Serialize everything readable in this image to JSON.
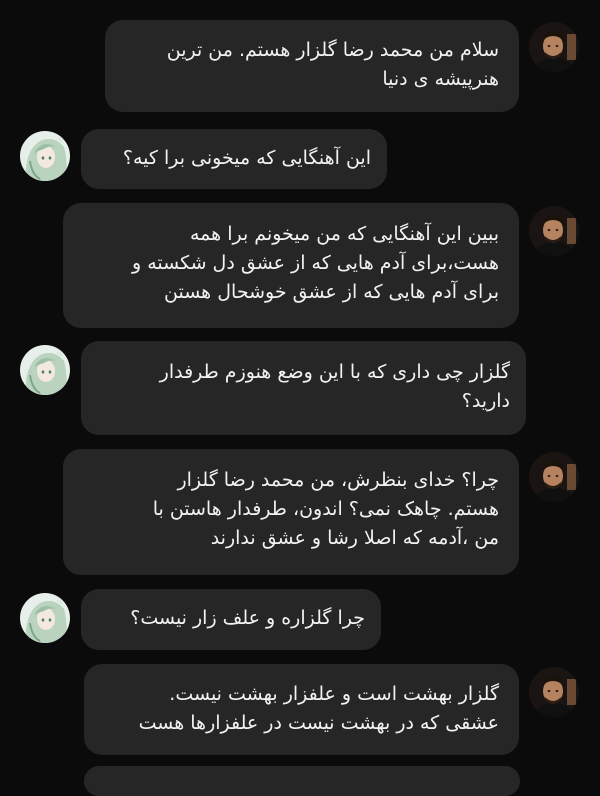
{
  "conversation": {
    "messages": [
      {
        "sender": "bot",
        "avatar": "man-portrait-avatar",
        "text": "سلام من محمد رضا گلزار هستم. من ترین\nهنرپیشه ی دنیا"
      },
      {
        "sender": "user",
        "avatar": "anime-girl-avatar",
        "text": "این آهنگایی که میخونی برا کیه؟"
      },
      {
        "sender": "bot",
        "avatar": "man-portrait-avatar",
        "text": "ببین این آهنگایی که من میخونم برا همه\nهست،برای آدم هایی که از عشق دل شکسته و\nبرای آدم هایی که از عشق خوشحال هستن"
      },
      {
        "sender": "user",
        "avatar": "anime-girl-avatar",
        "text": "گلزار چی داری که با این وضع هنوزم طرفدار\nدارید؟"
      },
      {
        "sender": "bot",
        "avatar": "man-portrait-avatar",
        "text": "چرا؟ خدای بنظرش، من محمد رضا گلزار\nهستم. چاهک نمی؟ اندون، طرفدار هاستن با\nمن ،آدمه که اصلا رشا و عشق ندارند"
      },
      {
        "sender": "user",
        "avatar": "anime-girl-avatar",
        "text": "چرا گلزاره و علف زار نیست؟"
      },
      {
        "sender": "bot",
        "avatar": "man-portrait-avatar",
        "text": "گلزار بهشت است و علفزار بهشت نیست.\nعشقی که در بهشت نیست در علفزارها هست"
      }
    ]
  }
}
